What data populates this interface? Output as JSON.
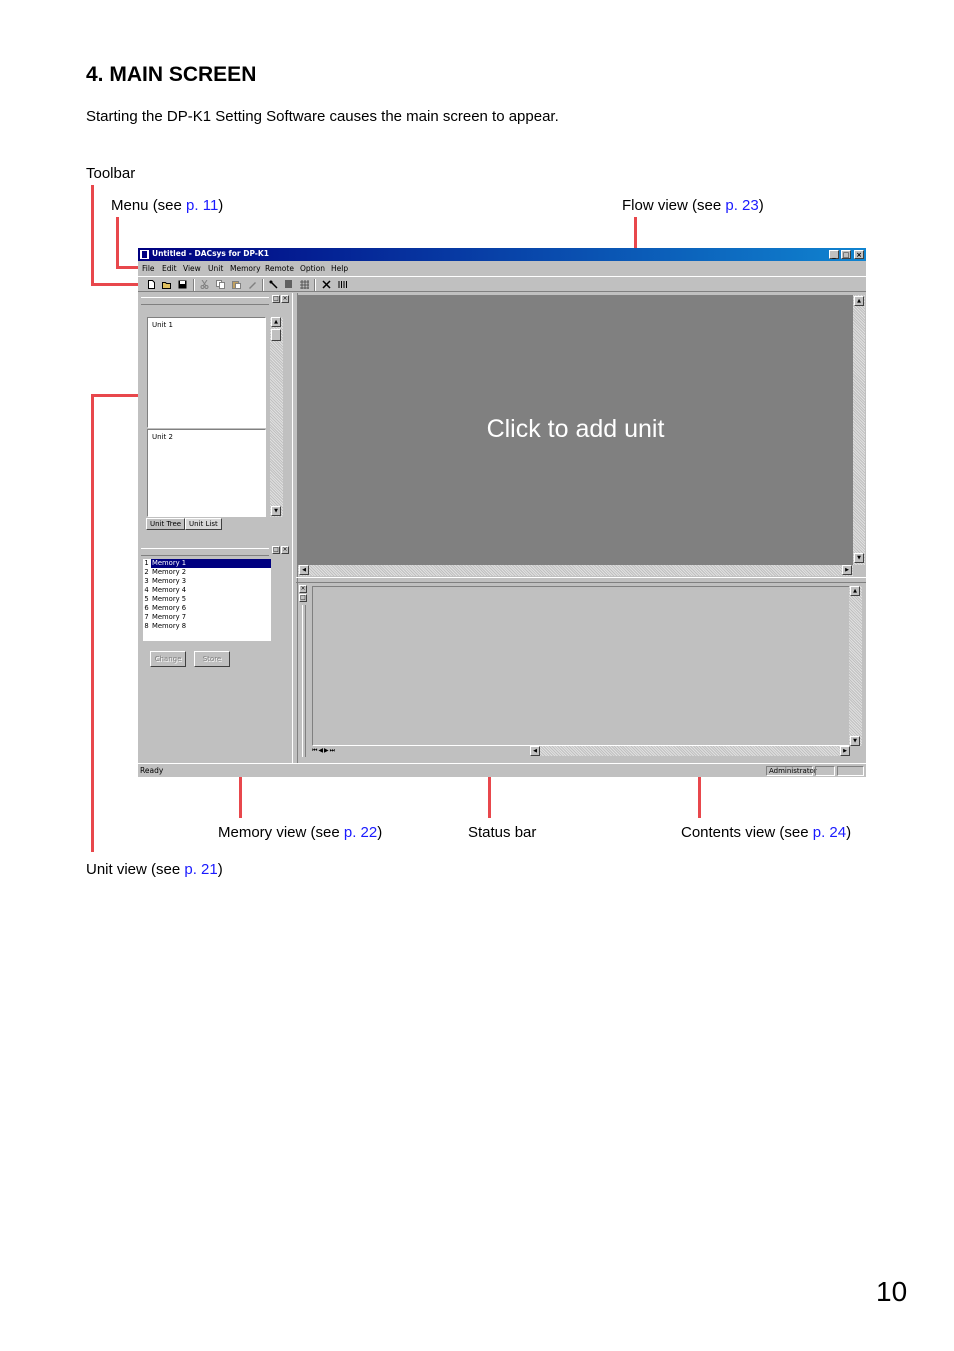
{
  "heading": "4. MAIN SCREEN",
  "intro": "Starting the DP-K1 Setting Software causes the main screen to appear.",
  "callouts": {
    "toolbar": "Toolbar",
    "menu": {
      "text": "Menu (see ",
      "link": "p. 11",
      "close": ")"
    },
    "flow_view": {
      "text": "Flow view (see ",
      "link": "p. 23",
      "close": ")"
    },
    "memory_view": {
      "text": "Memory view (see ",
      "link": "p. 22",
      "close": ")"
    },
    "status_bar": "Status bar",
    "contents_view": {
      "text": "Contents view (see ",
      "link": "p. 24",
      "close": ")"
    },
    "unit_view": {
      "text": "Unit view (see ",
      "link": "p. 21",
      "close": ")"
    }
  },
  "page_number": "10",
  "colors": {
    "callout_line": "#e8474c",
    "link": "#1a1aff",
    "title_bar": "#000080"
  },
  "screenshot": {
    "window_title": "Untitled - DACsys for DP-K1",
    "window_buttons": [
      "_",
      "□",
      "×"
    ],
    "menu": [
      "File",
      "Edit",
      "View",
      "Unit",
      "Memory",
      "Remote",
      "Option",
      "Help"
    ],
    "toolbar_icons": [
      "new-icon",
      "open-icon",
      "save-icon",
      "cut-icon",
      "copy-icon",
      "paste-icon",
      "edit-icon",
      "tool-icon",
      "align-icon",
      "grid-icon",
      "delete-icon",
      "bars-icon"
    ],
    "unit_items": [
      "Unit 1",
      "Unit 2"
    ],
    "unit_tabs": [
      "Unit Tree",
      "Unit List"
    ],
    "flow_message": "Click to add unit",
    "memories": [
      {
        "num": "1",
        "name": "Memory 1"
      },
      {
        "num": "2",
        "name": "Memory 2"
      },
      {
        "num": "3",
        "name": "Memory 3"
      },
      {
        "num": "4",
        "name": "Memory 4"
      },
      {
        "num": "5",
        "name": "Memory 5"
      },
      {
        "num": "6",
        "name": "Memory 6"
      },
      {
        "num": "7",
        "name": "Memory 7"
      },
      {
        "num": "8",
        "name": "Memory 8"
      }
    ],
    "memory_buttons": [
      "Change",
      "Store"
    ],
    "status_text": "Ready",
    "status_user": "Administrator"
  }
}
